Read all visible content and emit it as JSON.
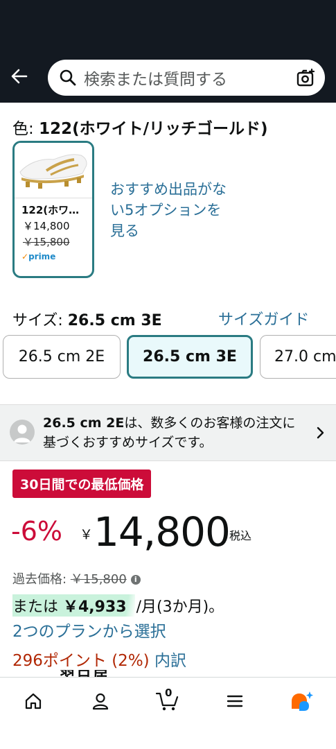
{
  "header": {
    "search_placeholder": "検索または質問する"
  },
  "color": {
    "prefix": "色: ",
    "value": "122(ホワイト/リッチゴールド)",
    "swatch": {
      "label": "122(ホワ…",
      "price": "￥14,800",
      "old_price": "￥15,800",
      "prime_check": "✓",
      "prime_text": "prime"
    },
    "no_recommendation": "おすすめ出品がない5オプションを見る"
  },
  "size": {
    "prefix": "サイズ: ",
    "value": "26.5 cm 3E",
    "guide_label": "サイズガイド",
    "options": [
      {
        "label": "26.5 cm 2E",
        "selected": false
      },
      {
        "label": "26.5 cm 3E",
        "selected": true
      },
      {
        "label": "27.0 cm",
        "selected": false
      }
    ]
  },
  "recommendation": {
    "size": "26.5 cm 2E",
    "text": "は、数多くのお客様の注文に基づくおすすめサイズです。"
  },
  "price": {
    "deal_badge": "30日間での最低価格",
    "discount": "-6%",
    "currency": "￥",
    "amount": "14,800",
    "tax_label": "税込",
    "list_price_label": "過去価格: ",
    "list_price": "￥15,800",
    "installment_prefix": "または ",
    "installment_amount": "￥4,933",
    "installment_suffix": "/月(3か月)。",
    "plans_link": "2つのプランから選択",
    "points": "296ポイント (2%)",
    "points_breakdown": "内訳",
    "cut_text": "翌日届"
  },
  "bottom_nav": {
    "cart_count": "0"
  },
  "colors": {
    "header_bg": "#131921",
    "accent_teal": "#2a7b82",
    "link": "#2a6f97",
    "deal_red": "#cc0c39",
    "installment_highlight": "#c9f2dc"
  }
}
